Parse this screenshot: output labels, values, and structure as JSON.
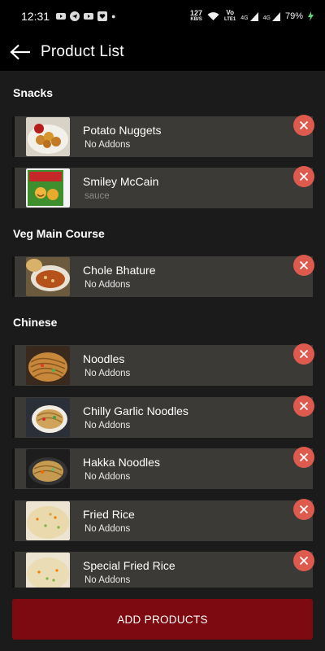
{
  "status_bar": {
    "time": "12:31",
    "speed_top": "127",
    "speed_bottom": "KB/S",
    "volte_top": "Vo",
    "volte_bottom": "LTE1",
    "net1": "4G",
    "net2": "4G",
    "battery": "79%"
  },
  "header": {
    "title": "Product List"
  },
  "sections": [
    {
      "title": "Snacks"
    },
    {
      "title": "Veg Main Course"
    },
    {
      "title": "Chinese"
    }
  ],
  "items": [
    {
      "name": "Potato Nuggets",
      "sub": "No Addons"
    },
    {
      "name": "Smiley McCain",
      "sub": "sauce"
    },
    {
      "name": "Chole Bhature",
      "sub": "No Addons"
    },
    {
      "name": "Noodles",
      "sub": "No Addons"
    },
    {
      "name": "Chilly Garlic Noodles",
      "sub": "No Addons"
    },
    {
      "name": "Hakka Noodles",
      "sub": "No Addons"
    },
    {
      "name": "Fried Rice",
      "sub": "No Addons"
    },
    {
      "name": "Special Fried Rice",
      "sub": "No Addons"
    }
  ],
  "footer": {
    "add_label": "ADD PRODUCTS"
  },
  "colors": {
    "accent": "#7d0a10",
    "remove": "#df5a4e",
    "card": "#3b3a37"
  }
}
